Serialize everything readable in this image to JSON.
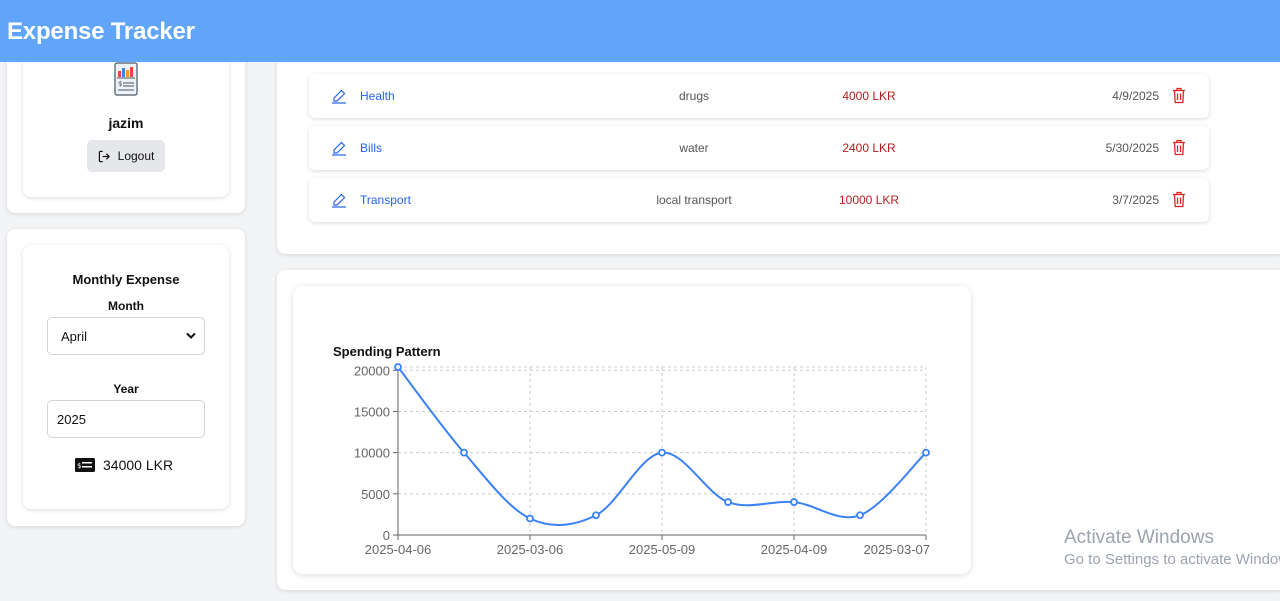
{
  "app": {
    "title": "Expense Tracker"
  },
  "profile": {
    "username": "jazim",
    "logout_label": "Logout",
    "avatar_icon": "receipt-chart-icon"
  },
  "monthly": {
    "title": "Monthly Expense",
    "month_label": "Month",
    "month_value": "April",
    "year_label": "Year",
    "year_value": "2025",
    "total": "34000 LKR",
    "total_icon": "money-bill-icon"
  },
  "expenses": [
    {
      "category": "Health",
      "description": "drugs",
      "amount": "4000 LKR",
      "date": "4/9/2025"
    },
    {
      "category": "Bills",
      "description": "water",
      "amount": "2400 LKR",
      "date": "5/30/2025"
    },
    {
      "category": "Transport",
      "description": "local transport",
      "amount": "10000 LKR",
      "date": "3/7/2025"
    }
  ],
  "colors": {
    "accent": "#60a5fa",
    "line": "#3b82f6",
    "amount": "#b91c1c",
    "link": "#2563eb"
  },
  "chart_data": {
    "type": "line",
    "title": "Spending Pattern",
    "x": [
      "2025-04-06",
      "",
      "2025-03-06",
      "",
      "2025-05-09",
      "",
      "2025-04-09",
      "",
      "2025-03-07"
    ],
    "x_ticks": [
      "2025-04-06",
      "2025-03-06",
      "2025-05-09",
      "2025-04-09",
      "2025-03-07"
    ],
    "values": [
      20400,
      10000,
      2000,
      2400,
      10000,
      4000,
      4000,
      2400,
      10000
    ],
    "y_ticks": [
      0,
      5000,
      10000,
      15000,
      20000
    ],
    "ylim": [
      0,
      20400
    ],
    "grid": true,
    "xlabel": "",
    "ylabel": ""
  },
  "watermark": {
    "line1": "Activate Windows",
    "line2": "Go to Settings to activate Windows."
  }
}
